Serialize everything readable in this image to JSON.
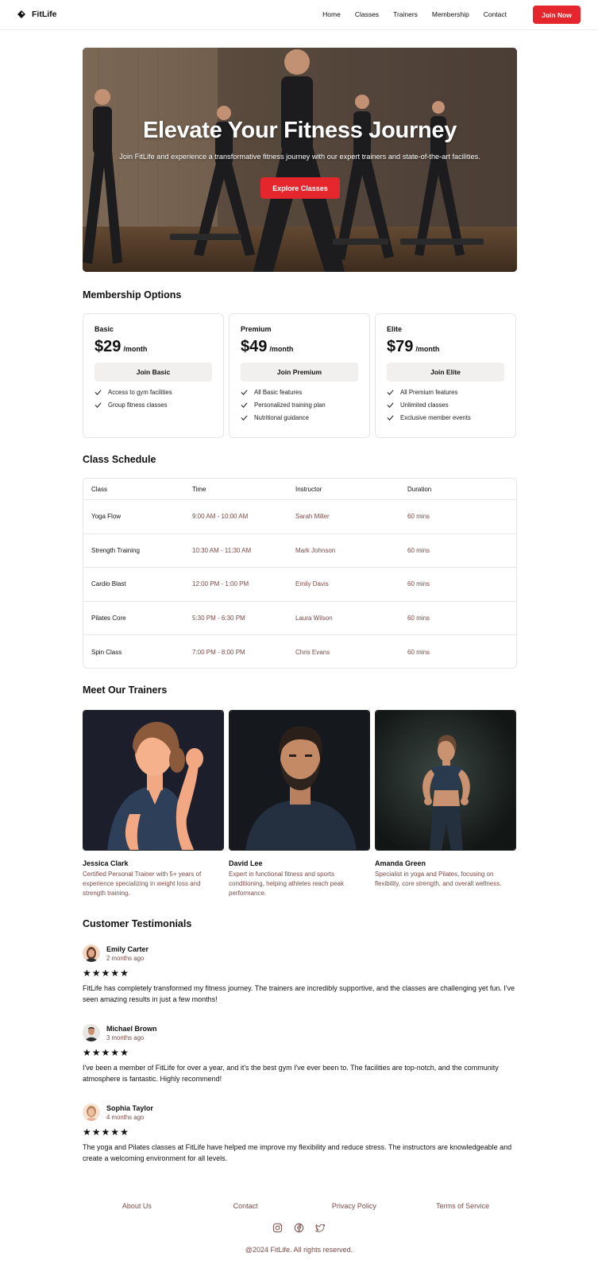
{
  "brand": {
    "name": "FitLife",
    "accent": "#e5262d"
  },
  "nav": {
    "links": [
      "Home",
      "Classes",
      "Trainers",
      "Membership",
      "Contact"
    ],
    "cta": "Join Now"
  },
  "hero": {
    "title": "Elevate Your Fitness Journey",
    "subtitle": "Join FitLife and experience a transformative fitness journey with our expert trainers and state-of-the-art facilities.",
    "button": "Explore Classes"
  },
  "membership": {
    "title": "Membership Options",
    "plans": [
      {
        "name": "Basic",
        "price": "$29",
        "period": "/month",
        "button": "Join Basic",
        "features": [
          "Access to gym facilities",
          "Group fitness classes"
        ]
      },
      {
        "name": "Premium",
        "price": "$49",
        "period": "/month",
        "button": "Join Premium",
        "features": [
          "All Basic features",
          "Personalized training plan",
          "Nutritional guidance"
        ]
      },
      {
        "name": "Elite",
        "price": "$79",
        "period": "/month",
        "button": "Join Elite",
        "features": [
          "All Premium features",
          "Unlimited classes",
          "Exclusive member events"
        ]
      }
    ]
  },
  "schedule": {
    "title": "Class Schedule",
    "columns": [
      "Class",
      "Time",
      "Instructor",
      "Duration"
    ],
    "rows": [
      [
        "Yoga Flow",
        "9:00 AM - 10:00 AM",
        "Sarah Miller",
        "60 mins"
      ],
      [
        "Strength Training",
        "10:30 AM - 11:30 AM",
        "Mark Johnson",
        "60 mins"
      ],
      [
        "Cardio Blast",
        "12:00 PM - 1:00 PM",
        "Emily Davis",
        "60 mins"
      ],
      [
        "Pilates Core",
        "5:30 PM - 6:30 PM",
        "Laura Wilson",
        "60 mins"
      ],
      [
        "Spin Class",
        "7:00 PM - 8:00 PM",
        "Chris Evans",
        "60 mins"
      ]
    ]
  },
  "trainers": {
    "title": "Meet Our Trainers",
    "items": [
      {
        "name": "Jessica Clark",
        "bio": "Certified Personal Trainer with 5+ years of experience specializing in weight loss and strength training."
      },
      {
        "name": "David Lee",
        "bio": "Expert in functional fitness and sports conditioning, helping athletes reach peak performance."
      },
      {
        "name": "Amanda Green",
        "bio": "Specialist in yoga and Pilates, focusing on flexibility, core strength, and overall wellness."
      }
    ]
  },
  "testimonials": {
    "title": "Customer Testimonials",
    "items": [
      {
        "name": "Emily Carter",
        "when": "2 months ago",
        "rating": 5,
        "text": "FitLife has completely transformed my fitness journey. The trainers are incredibly supportive, and the classes are challenging yet fun. I've seen amazing results in just a few months!"
      },
      {
        "name": "Michael Brown",
        "when": "3 months ago",
        "rating": 5,
        "text": "I've been a member of FitLife for over a year, and it's the best gym I've ever been to. The facilities are top-notch, and the community atmosphere is fantastic. Highly recommend!"
      },
      {
        "name": "Sophia Taylor",
        "when": "4 months ago",
        "rating": 5,
        "text": "The yoga and Pilates classes at FitLife have helped me improve my flexibility and reduce stress. The instructors are knowledgeable and create a welcoming environment for all levels."
      }
    ]
  },
  "footer": {
    "links": [
      "About Us",
      "Contact",
      "Privacy Policy",
      "Terms of Service"
    ],
    "socials": [
      "instagram-icon",
      "facebook-icon",
      "twitter-icon"
    ],
    "copyright": "@2024 FitLife. All rights reserved."
  }
}
